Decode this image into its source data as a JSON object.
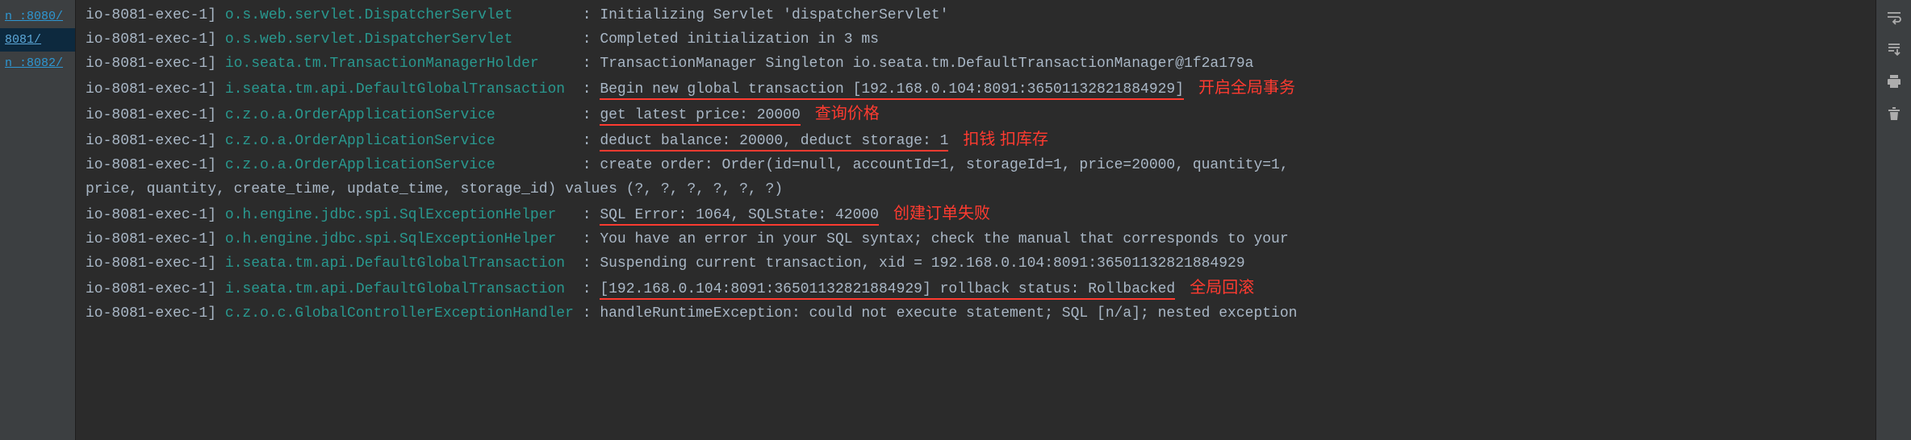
{
  "tabs": {
    "items": [
      {
        "label": "n :8080/",
        "active": false
      },
      {
        "label": "8081/",
        "active": true
      },
      {
        "label": "n :8082/",
        "active": false
      }
    ]
  },
  "log": {
    "lines": [
      {
        "thread": "io-8081-exec-1] ",
        "logger": "o.s.web.servlet.DispatcherServlet       ",
        "colon": " : ",
        "msg": "Initializing Servlet 'dispatcherServlet'",
        "underline": false,
        "annot": ""
      },
      {
        "thread": "io-8081-exec-1] ",
        "logger": "o.s.web.servlet.DispatcherServlet       ",
        "colon": " : ",
        "msg": "Completed initialization in 3 ms",
        "underline": false,
        "annot": ""
      },
      {
        "thread": "io-8081-exec-1] ",
        "logger": "io.seata.tm.TransactionManagerHolder    ",
        "colon": " : ",
        "msg": "TransactionManager Singleton io.seata.tm.DefaultTransactionManager@1f2a179a",
        "underline": false,
        "annot": ""
      },
      {
        "thread": "io-8081-exec-1] ",
        "logger": "i.seata.tm.api.DefaultGlobalTransaction ",
        "colon": " : ",
        "msg": "Begin new global transaction [192.168.0.104:8091:36501132821884929]",
        "underline": true,
        "annot": "开启全局事务"
      },
      {
        "thread": "io-8081-exec-1] ",
        "logger": "c.z.o.a.OrderApplicationService         ",
        "colon": " : ",
        "msg": "get latest price: 20000",
        "underline": true,
        "annot": "查询价格"
      },
      {
        "thread": "io-8081-exec-1] ",
        "logger": "c.z.o.a.OrderApplicationService         ",
        "colon": " : ",
        "msg": "deduct balance: 20000, deduct storage: 1",
        "underline": true,
        "annot": "扣钱 扣库存"
      },
      {
        "thread": "io-8081-exec-1] ",
        "logger": "c.z.o.a.OrderApplicationService         ",
        "colon": " : ",
        "msg": "create order: Order(id=null, accountId=1, storageId=1, price=20000, quantity=1,",
        "underline": false,
        "annot": ""
      },
      {
        "thread": "price, quantity, create_time, update_time, storage_id) values (?, ?, ?, ?, ?, ?)",
        "logger": "",
        "colon": "",
        "msg": "",
        "underline": false,
        "annot": ""
      },
      {
        "thread": "io-8081-exec-1] ",
        "logger": "o.h.engine.jdbc.spi.SqlExceptionHelper  ",
        "colon": " : ",
        "msg": "SQL Error: 1064, SQLState: 42000",
        "underline": true,
        "annot": "创建订单失败"
      },
      {
        "thread": "io-8081-exec-1] ",
        "logger": "o.h.engine.jdbc.spi.SqlExceptionHelper  ",
        "colon": " : ",
        "msg": "You have an error in your SQL syntax; check the manual that corresponds to your ",
        "underline": false,
        "annot": ""
      },
      {
        "thread": "io-8081-exec-1] ",
        "logger": "i.seata.tm.api.DefaultGlobalTransaction ",
        "colon": " : ",
        "msg": "Suspending current transaction, xid = 192.168.0.104:8091:36501132821884929",
        "underline": false,
        "annot": ""
      },
      {
        "thread": "io-8081-exec-1] ",
        "logger": "i.seata.tm.api.DefaultGlobalTransaction ",
        "colon": " : ",
        "msg": "[192.168.0.104:8091:36501132821884929] rollback status: Rollbacked",
        "underline": true,
        "annot": "全局回滚"
      },
      {
        "thread": "io-8081-exec-1] ",
        "logger": "c.z.o.c.GlobalControllerExceptionHandler",
        "colon": " : ",
        "msg": "handleRuntimeException: could not execute statement; SQL [n/a]; nested exception",
        "underline": false,
        "annot": ""
      }
    ]
  },
  "toolbar_icons": {
    "soft_wrap": "soft-wrap",
    "scroll_end": "scroll-end",
    "print": "print",
    "delete": "delete"
  }
}
